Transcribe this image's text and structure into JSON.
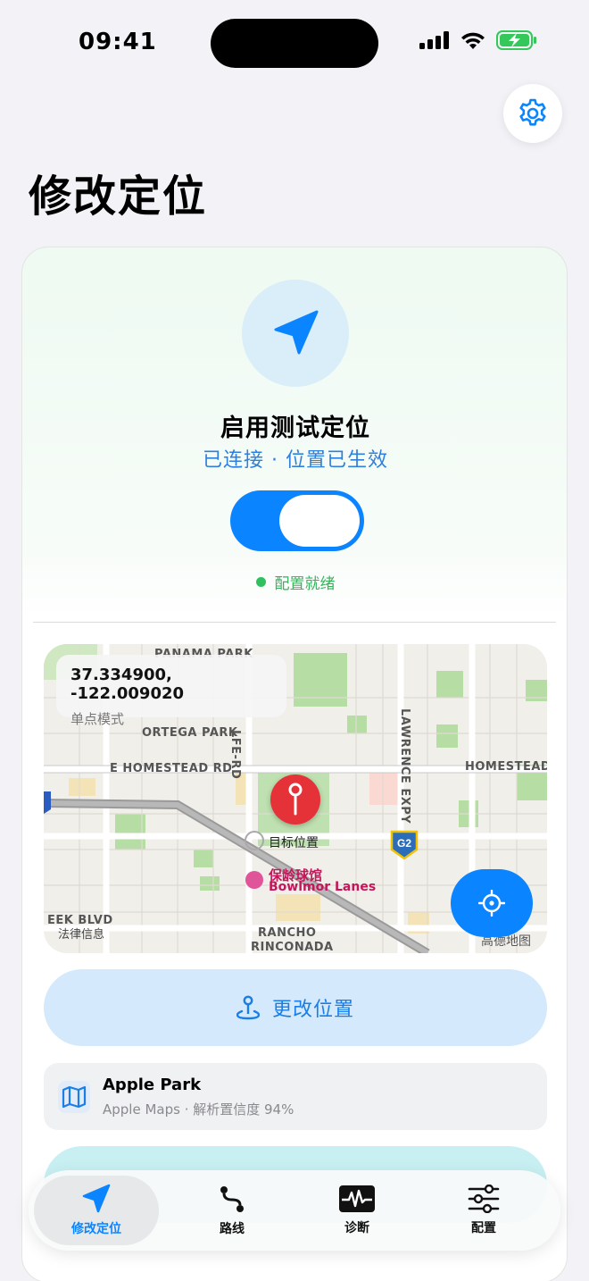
{
  "status_bar": {
    "time": "09:41"
  },
  "page": {
    "title": "修改定位"
  },
  "hero": {
    "title": "启用测试定位",
    "subtitle": "已连接 · 位置已生效",
    "toggle_on": true,
    "status_text": "配置就绪"
  },
  "map": {
    "coordinates": "37.334900, -122.009020",
    "mode": "单点模式",
    "pin_label": "目标位置",
    "street_labels": [
      "PANAMA PARK",
      "ORTEGA PARK",
      "E HOMESTEAD RD",
      "HOMESTEAD",
      "LFE-RD",
      "LAWRENCE EXPY",
      "EEK BLVD",
      "RANCHO",
      "RINCONADA"
    ],
    "highway_badge": "G2",
    "poi_cn": "保龄球馆",
    "poi_en": "Bowlmor Lanes",
    "legal": "法律信息",
    "provider": "高德地图"
  },
  "actions": {
    "change_location": "更改位置"
  },
  "place": {
    "name": "Apple Park",
    "detail": "Apple Maps · 解析置信度 94%"
  },
  "tabs": [
    {
      "label": "修改定位",
      "icon": "location-arrow-icon",
      "active": true
    },
    {
      "label": "路线",
      "icon": "route-icon",
      "active": false
    },
    {
      "label": "诊断",
      "icon": "waveform-icon",
      "active": false
    },
    {
      "label": "配置",
      "icon": "sliders-icon",
      "active": false
    }
  ],
  "colors": {
    "accent": "#0a84ff",
    "ready": "#34b45a",
    "pin": "#e53238"
  }
}
